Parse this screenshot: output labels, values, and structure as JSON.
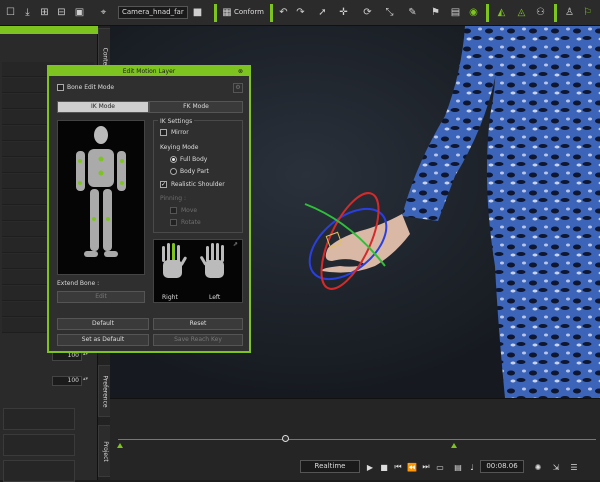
{
  "toolbar": {
    "camera_select": "Camera_hnad_far",
    "conform_label": "Conform",
    "icons": [
      "new-icon",
      "save-icon",
      "fit-icon",
      "grid-icon",
      "camera-zoom-icon",
      "camera-icon",
      "undo-icon",
      "redo-icon",
      "select-icon",
      "move-icon",
      "rotate-icon",
      "scale-icon",
      "paint-icon",
      "flag-icon",
      "eye-icon",
      "bone-ik-icon",
      "pin-icon",
      "group-icon",
      "person-icon",
      "flag2-icon"
    ]
  },
  "side_tabs": {
    "content": "Content",
    "preference": "Preference",
    "project": "Project"
  },
  "left_panel": {
    "spin1": "100",
    "spin2": "100"
  },
  "dialog": {
    "title": "Edit Motion Layer",
    "bone_edit_mode": "Bone Edit Mode",
    "tabs": {
      "ik": "IK Mode",
      "fk": "FK Mode"
    },
    "extend_bone": "Extend Bone :",
    "edit_button": "Edit",
    "ik_settings": "IK Settings",
    "mirror": "Mirror",
    "keying_mode": "Keying Mode",
    "full_body": "Full Body",
    "body_part": "Body Part",
    "realistic_shoulder": "Realistic Shoulder",
    "pinning": "Pinning :",
    "move": "Move",
    "rotate": "Rotate",
    "hand_right": "Right",
    "hand_left": "Left",
    "default_btn1": "Default",
    "reset_btn": "Reset",
    "set_as_default": "Set as Default",
    "save_reach_key": "Save Reach Key"
  },
  "timeline": {
    "realtime": "Realtime",
    "time": "00:08.06",
    "progress": 0.35
  },
  "colors": {
    "accent": "#7ec421",
    "ring_red": "#d62a2a",
    "ring_blue": "#2a3fe0",
    "ring_green": "#2fbf3a"
  }
}
